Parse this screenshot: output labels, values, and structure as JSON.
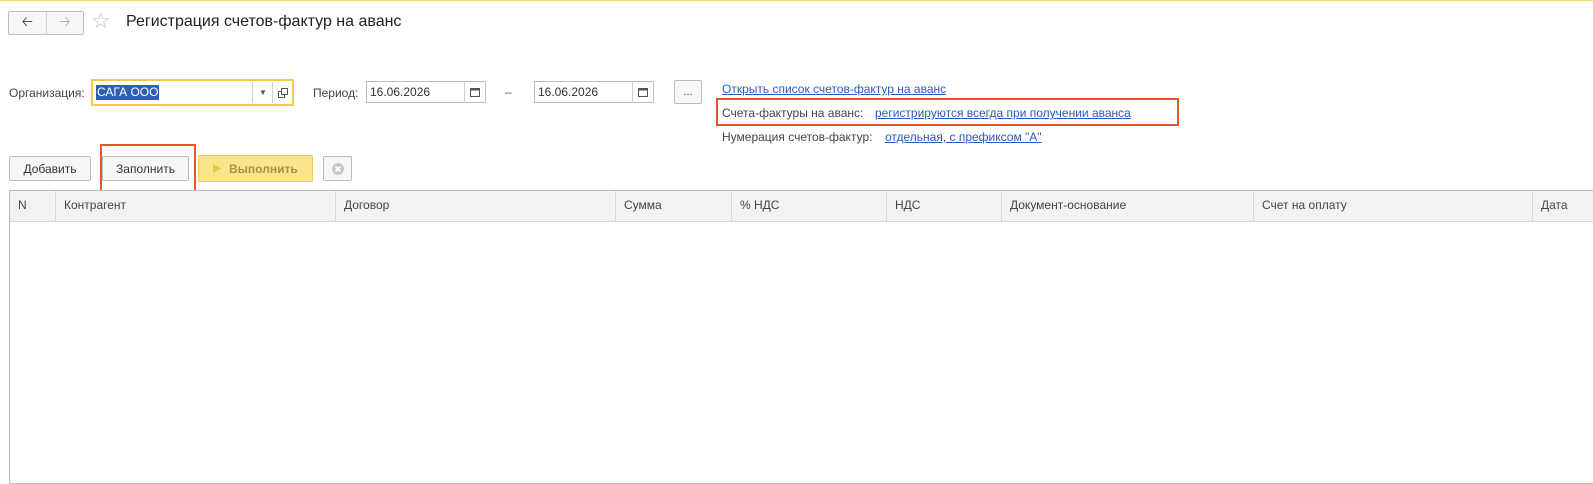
{
  "window": {
    "title": "Регистрация счетов-фактур на аванс",
    "back_icon": "arrow-left-icon",
    "forward_icon": "arrow-right-icon",
    "favorite_icon": "star-icon"
  },
  "filters": {
    "organization_label": "Организация:",
    "organization_value": "САГА ООО",
    "period_label": "Период:",
    "date_from": "16.06.2026",
    "period_dash": "–",
    "date_to": "16.06.2026",
    "period_select_label": "..."
  },
  "info": {
    "open_list_link": "Открыть список счетов-фактур на аванс",
    "invoices_label": "Счета-фактуры на аванс:",
    "invoices_link": "регистрируются всегда при получении аванса",
    "numbering_label": "Нумерация счетов-фактур:",
    "numbering_link": "отдельная, с префиксом \"А\""
  },
  "toolbar": {
    "add_label": "Добавить",
    "fill_label": "Заполнить",
    "run_label": "Выполнить"
  },
  "table": {
    "columns": [
      "N",
      "Контрагент",
      "Договор",
      "Сумма",
      "% НДС",
      "НДС",
      "Документ-основание",
      "Счет на оплату",
      "Дата"
    ],
    "rows": []
  },
  "colors": {
    "accent_yellow": "#f2c94c",
    "highlight_red": "#e8542b",
    "link_blue": "#1f5fbf",
    "selection_blue": "#2d5fb8"
  }
}
